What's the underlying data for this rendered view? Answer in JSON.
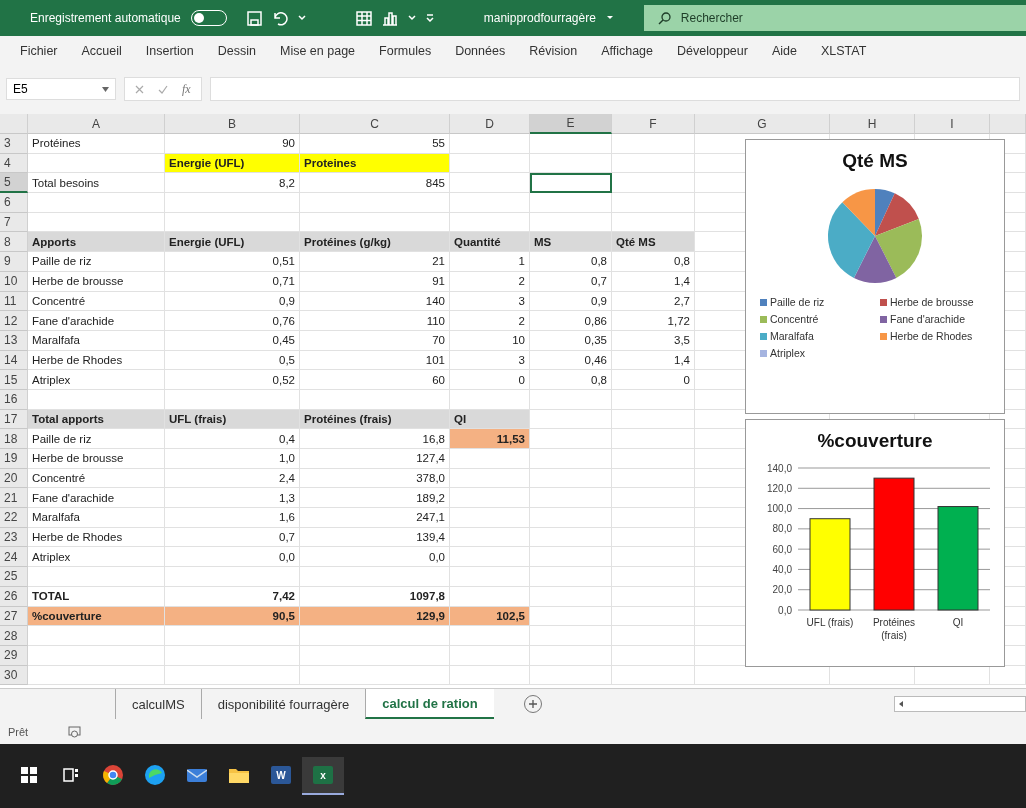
{
  "title_bar": {
    "autosave_label": "Enregistrement automatique",
    "autosave_on": false,
    "filename": "manipprodfourragère",
    "search": {
      "placeholder": "Rechercher"
    }
  },
  "ribbon_tabs": [
    "Fichier",
    "Accueil",
    "Insertion",
    "Dessin",
    "Mise en page",
    "Formules",
    "Données",
    "Révision",
    "Affichage",
    "Développeur",
    "Aide",
    "XLSTAT"
  ],
  "formula_bar": {
    "name_box": "E5",
    "function_label": "fx"
  },
  "sheet": {
    "columns": [
      {
        "label": "A",
        "selected": false
      },
      {
        "label": "B",
        "selected": false
      },
      {
        "label": "C",
        "selected": false
      },
      {
        "label": "D",
        "selected": false
      },
      {
        "label": "E",
        "selected": true
      },
      {
        "label": "F",
        "selected": false
      },
      {
        "label": "G",
        "selected": false
      },
      {
        "label": "H",
        "selected": false
      },
      {
        "label": "I",
        "selected": false
      }
    ],
    "rows": [
      {
        "number": "3",
        "selected": false,
        "cells": [
          {
            "text": "Protéines"
          },
          {
            "text": "90"
          },
          {
            "text": "55"
          }
        ]
      },
      {
        "number": "4",
        "selected": false,
        "heading": true,
        "bold": true,
        "cells": [
          null,
          {
            "text": "Energie (UFL)",
            "color": "#ffff00"
          },
          {
            "text": "Proteines",
            "color": "#ffff00"
          }
        ]
      },
      {
        "number": "5",
        "selected": true,
        "cells": [
          {
            "text": "Total besoins"
          },
          {
            "text": "8,2"
          },
          {
            "text": "845"
          }
        ]
      },
      {
        "number": "6",
        "selected": false
      },
      {
        "number": "7",
        "selected": false
      },
      {
        "number": "8",
        "selected": false,
        "heading": true,
        "bold": true,
        "cells": [
          {
            "text": "Apports",
            "color": "#d9d9d9"
          },
          {
            "text": "Energie (UFL)",
            "color": "#d9d9d9"
          },
          {
            "text": "Protéines (g/kg)",
            "color": "#d9d9d9"
          },
          {
            "text": "Quantité",
            "color": "#d9d9d9"
          },
          {
            "text": "MS",
            "color": "#d9d9d9"
          },
          {
            "text": "Qté MS",
            "color": "#d9d9d9"
          }
        ]
      },
      {
        "number": "9",
        "selected": false,
        "cells": [
          {
            "text": "Paille de riz"
          },
          {
            "text": "0,51"
          },
          {
            "text": "21"
          },
          {
            "text": "1"
          },
          {
            "text": "0,8"
          },
          {
            "text": "0,8"
          }
        ]
      },
      {
        "number": "10",
        "selected": false,
        "cells": [
          {
            "text": "Herbe de brousse"
          },
          {
            "text": "0,71"
          },
          {
            "text": "91"
          },
          {
            "text": "2"
          },
          {
            "text": "0,7"
          },
          {
            "text": "1,4"
          }
        ]
      },
      {
        "number": "11",
        "selected": false,
        "cells": [
          {
            "text": "Concentré"
          },
          {
            "text": "0,9"
          },
          {
            "text": "140"
          },
          {
            "text": "3"
          },
          {
            "text": "0,9"
          },
          {
            "text": "2,7"
          }
        ]
      },
      {
        "number": "12",
        "selected": false,
        "cells": [
          {
            "text": "Fane d'arachide"
          },
          {
            "text": "0,76"
          },
          {
            "text": "110"
          },
          {
            "text": "2"
          },
          {
            "text": "0,86"
          },
          {
            "text": "1,72"
          }
        ]
      },
      {
        "number": "13",
        "selected": false,
        "cells": [
          {
            "text": "Maralfafa"
          },
          {
            "text": "0,45"
          },
          {
            "text": "70"
          },
          {
            "text": "10"
          },
          {
            "text": "0,35"
          },
          {
            "text": "3,5"
          }
        ]
      },
      {
        "number": "14",
        "selected": false,
        "cells": [
          {
            "text": "Herbe de Rhodes"
          },
          {
            "text": "0,5"
          },
          {
            "text": "101"
          },
          {
            "text": "3"
          },
          {
            "text": "0,46"
          },
          {
            "text": "1,4"
          }
        ]
      },
      {
        "number": "15",
        "selected": false,
        "cells": [
          {
            "text": "Atriplex"
          },
          {
            "text": "0,52"
          },
          {
            "text": "60"
          },
          {
            "text": "0"
          },
          {
            "text": "0,8"
          },
          {
            "text": "0"
          }
        ]
      },
      {
        "number": "16",
        "selected": false
      },
      {
        "number": "17",
        "selected": false,
        "heading": true,
        "bold": true,
        "cells": [
          {
            "text": "Total apports",
            "color": "#d9d9d9"
          },
          {
            "text": "UFL (frais)",
            "color": "#d9d9d9"
          },
          {
            "text": "Protéines (frais)",
            "color": "#d9d9d9"
          },
          {
            "text": "QI",
            "color": "#d9d9d9"
          }
        ]
      },
      {
        "number": "18",
        "selected": false,
        "cells": [
          {
            "text": "Paille de riz"
          },
          {
            "text": "0,4"
          },
          {
            "text": "16,8"
          },
          {
            "text": "11,53",
            "color": "#f4b183",
            "bold": true
          }
        ]
      },
      {
        "number": "19",
        "selected": false,
        "cells": [
          {
            "text": "Herbe de brousse"
          },
          {
            "text": "1,0"
          },
          {
            "text": "127,4"
          }
        ]
      },
      {
        "number": "20",
        "selected": false,
        "cells": [
          {
            "text": "Concentré"
          },
          {
            "text": "2,4"
          },
          {
            "text": "378,0"
          }
        ]
      },
      {
        "number": "21",
        "selected": false,
        "cells": [
          {
            "text": "Fane d'arachide"
          },
          {
            "text": "1,3"
          },
          {
            "text": "189,2"
          }
        ]
      },
      {
        "number": "22",
        "selected": false,
        "cells": [
          {
            "text": "Maralfafa"
          },
          {
            "text": "1,6"
          },
          {
            "text": "247,1"
          }
        ]
      },
      {
        "number": "23",
        "selected": false,
        "cells": [
          {
            "text": "Herbe de Rhodes"
          },
          {
            "text": "0,7"
          },
          {
            "text": "139,4"
          }
        ]
      },
      {
        "number": "24",
        "selected": false,
        "cells": [
          {
            "text": "Atriplex"
          },
          {
            "text": "0,0"
          },
          {
            "text": "0,0"
          }
        ]
      },
      {
        "number": "25",
        "selected": false
      },
      {
        "number": "26",
        "selected": false,
        "bold": true,
        "cells": [
          {
            "text": "TOTAL"
          },
          {
            "text": "7,42"
          },
          {
            "text": "1097,8"
          }
        ]
      },
      {
        "number": "27",
        "selected": false,
        "bold": true,
        "cells": [
          {
            "text": "%couverture",
            "color": "#f4b183"
          },
          {
            "text": "90,5",
            "color": "#f4b183"
          },
          {
            "text": "129,9",
            "color": "#f4b183"
          },
          {
            "text": "102,5",
            "color": "#f4b183"
          }
        ]
      },
      {
        "number": "28",
        "selected": false
      },
      {
        "number": "29",
        "selected": false
      },
      {
        "number": "30",
        "selected": false
      }
    ],
    "pie_chart": {
      "chart_data": {
        "type": "pie",
        "title": "Qté MS",
        "categories": [
          "Paille de riz",
          "Herbe de brousse",
          "Concentré",
          "Fane d'arachide",
          "Maralfafa",
          "Herbe de Rhodes",
          "Atriplex"
        ],
        "series": [
          {
            "values": [
              6.9,
              12.2,
              23.4,
              14.9,
              30.4,
              12.2,
              0
            ]
          }
        ]
      }
    },
    "bar_chart": {
      "chart_data": {
        "type": "bar",
        "title": "%couverture",
        "categories": [
          "UFL (frais)",
          "Protéines (frais)",
          "QI"
        ],
        "series": [
          {
            "values": [
              90,
              130,
              102
            ]
          }
        ],
        "grid": true,
        "ylim": [
          0,
          140
        ],
        "yticks": [
          {
            "value": 0,
            "label": "0,0"
          },
          {
            "value": 20,
            "label": "20,0"
          },
          {
            "value": 40,
            "label": "40,0"
          },
          {
            "value": 60,
            "label": "60,0"
          },
          {
            "value": 80,
            "label": "80,0"
          },
          {
            "value": 100,
            "label": "100,0"
          },
          {
            "value": 120,
            "label": "120,0"
          },
          {
            "value": 140,
            "label": "140,0"
          }
        ]
      }
    }
  },
  "sheet_tabs": [
    {
      "label": "calculMS",
      "selected": false
    },
    {
      "label": "disponibilité fourragère",
      "selected": false
    },
    {
      "label": "calcul de ration",
      "selected": true
    }
  ],
  "status_bar": {
    "text": "Prêt"
  },
  "taskbar": [
    {
      "kind": "windows",
      "selected": false
    },
    {
      "kind": "taskview",
      "selected": false
    },
    {
      "kind": "browser",
      "selected": false
    },
    {
      "kind": "swirl",
      "selected": false
    },
    {
      "kind": "mail",
      "selected": false
    },
    {
      "kind": "folder",
      "selected": false
    },
    {
      "kind": "document",
      "badge": "W",
      "selected": false
    },
    {
      "kind": "spreadsheet",
      "badge": "x",
      "selected": true
    }
  ]
}
